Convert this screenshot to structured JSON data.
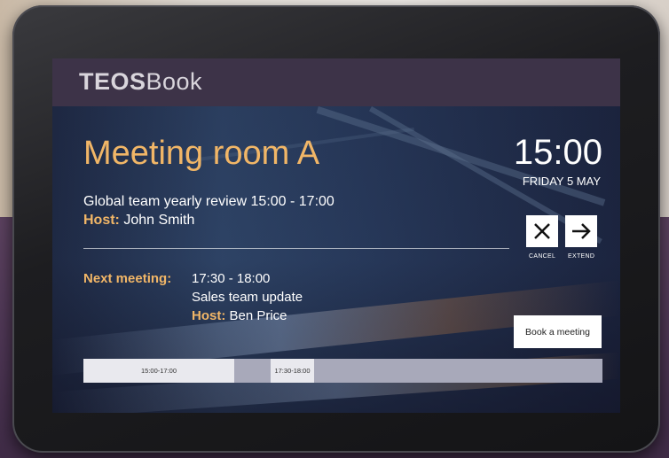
{
  "app": {
    "brand_bold": "TEOS",
    "brand_light": "Book"
  },
  "room": {
    "name": "Meeting room A"
  },
  "clock": {
    "time": "15:00",
    "date": "FRIDAY 5 MAY"
  },
  "current_meeting": {
    "title_time": "Global team yearly review 15:00 - 17:00",
    "host_label": "Host:",
    "host_name": " John Smith"
  },
  "actions": {
    "cancel_label": "CANCEL",
    "extend_label": "EXTEND",
    "book_label": "Book a meeting"
  },
  "next_meeting": {
    "label": "Next meeting:",
    "time": "17:30 - 18:00",
    "title": "Sales team update",
    "host_label": "Host:",
    "host_name": " Ben Price"
  },
  "timeline": {
    "slots": [
      {
        "label": "15:00-17:00"
      },
      {
        "label": "17:30-18:00"
      }
    ]
  },
  "colors": {
    "accent": "#f1b667",
    "topbar": "#3d3348",
    "timeline_track": "#a8a9ba",
    "timeline_slot": "#e9e9ee"
  },
  "icons": {
    "cancel": "close-icon",
    "extend": "arrow-right-icon"
  }
}
